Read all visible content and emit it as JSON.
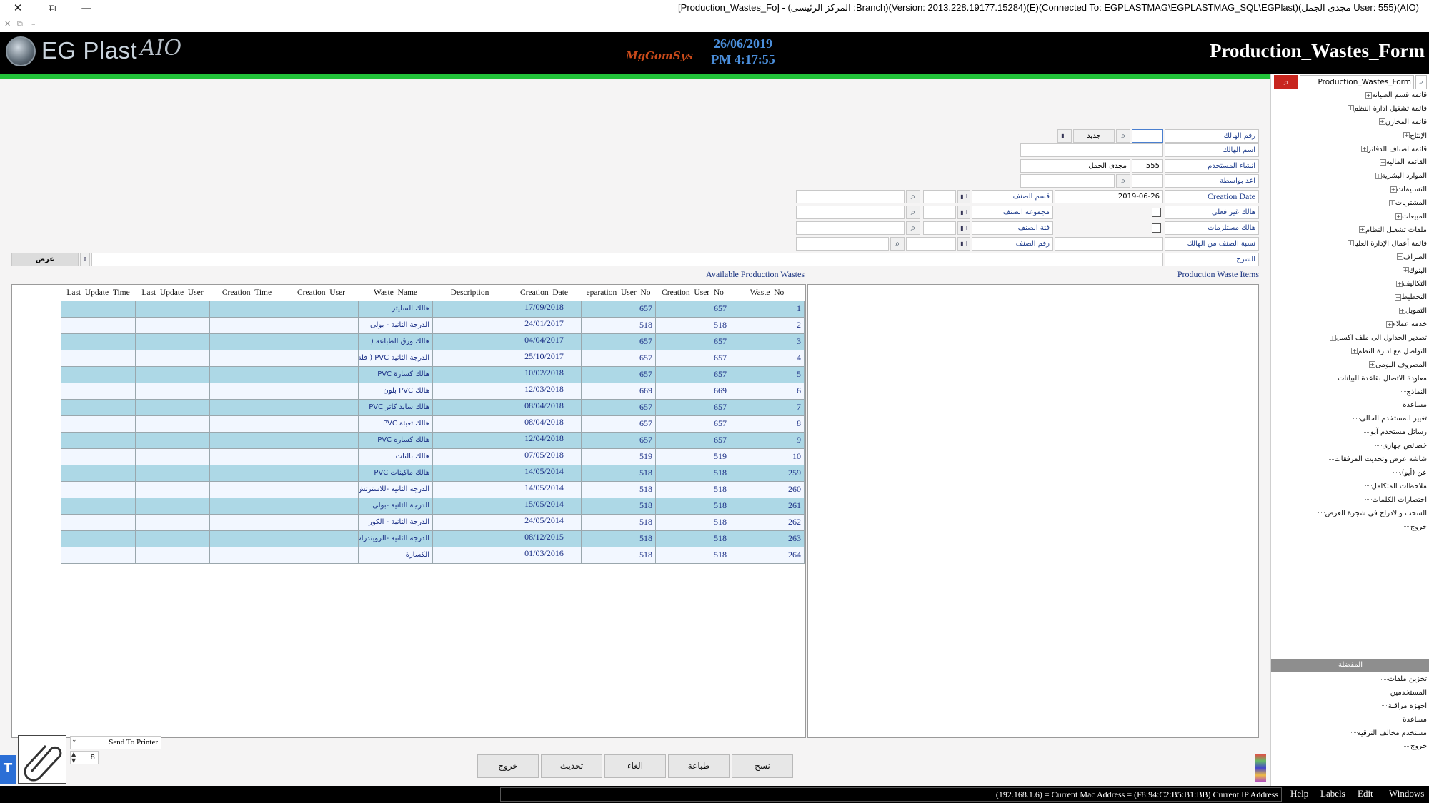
{
  "window": {
    "title": "[Production_Wastes_Fo] - (المركز الرئيسى :Branch)(Version: 2013.228.19177.15284)(E)(Connected To: EGPLASTMAG\\EGPLASTMAG_SQL\\EGPlast)(مجدى الجمل User: 555)(AIO)",
    "close": "✕",
    "restore": "⧉",
    "minimize": "—",
    "mdi_close": "✕",
    "mdi_restore": "⧉",
    "mdi_min": "–"
  },
  "header": {
    "logo_text": "EG Plast",
    "logo_suffix": "AIO",
    "vendor": "MgGomSys",
    "date": "26/06/2019",
    "time": "PM 4:17:55",
    "form_title": "Production_Wastes_Form"
  },
  "form": {
    "waste_no_label": "رقم الهالك",
    "new_label": "جديد",
    "waste_name_label": "اسم الهالك",
    "created_by_label": "انشاء المستخدم",
    "created_by_id": "555",
    "created_by_name": "مجدى الجمل",
    "prepared_by_label": "اعد بواسطة",
    "creation_date_label": "Creation Date",
    "creation_date": "2019-06-26",
    "non_actual_label": "هالك غير فعلي",
    "supplies_label": "هالك مستلزمات",
    "percent_label": "نسبة الصنف من الهالك",
    "notes_label": "الشرح",
    "item_section_label": "قسم الصنف",
    "item_group_label": "مجموعة الصنف",
    "item_class_label": "فئة الصنف",
    "item_no_label": "رقم الصنف",
    "show_label": "عرض"
  },
  "grids": {
    "left_caption": "Production Waste Items",
    "right_caption": "Available Production Wastes",
    "columns": [
      "Last_Update_Time",
      "Last_Update_User",
      "Creation_Time",
      "Creation_User",
      "Waste_Name",
      "Description",
      "Creation_Date",
      "eparation_User_No",
      "Creation_User_No",
      "Waste_No"
    ],
    "rows": [
      {
        "waste_no": "1",
        "cu_no": "657",
        "pu_no": "657",
        "date": "17/09/2018",
        "name": "هالك السليتر"
      },
      {
        "waste_no": "2",
        "cu_no": "518",
        "pu_no": "518",
        "date": "24/01/2017",
        "name": "الدرجة الثانية - بولى"
      },
      {
        "waste_no": "3",
        "cu_no": "657",
        "pu_no": "657",
        "date": "04/04/2017",
        "name": "هالك ورق الطباعة ("
      },
      {
        "waste_no": "4",
        "cu_no": "657",
        "pu_no": "657",
        "date": "25/10/2017",
        "name": "الدرجة الثانية PVC ( فلة"
      },
      {
        "waste_no": "5",
        "cu_no": "657",
        "pu_no": "657",
        "date": "10/02/2018",
        "name": "هالك كسارة PVC"
      },
      {
        "waste_no": "6",
        "cu_no": "669",
        "pu_no": "669",
        "date": "12/03/2018",
        "name": "هالك PVC بلون"
      },
      {
        "waste_no": "7",
        "cu_no": "657",
        "pu_no": "657",
        "date": "08/04/2018",
        "name": "هالك سايد كاتر PVC"
      },
      {
        "waste_no": "8",
        "cu_no": "657",
        "pu_no": "657",
        "date": "08/04/2018",
        "name": "هالك تعبئة PVC"
      },
      {
        "waste_no": "9",
        "cu_no": "657",
        "pu_no": "657",
        "date": "12/04/2018",
        "name": "هالك كسارة PVC"
      },
      {
        "waste_no": "10",
        "cu_no": "519",
        "pu_no": "519",
        "date": "07/05/2018",
        "name": "هالك بالتات"
      },
      {
        "waste_no": "259",
        "cu_no": "518",
        "pu_no": "518",
        "date": "14/05/2014",
        "name": "هالك ماكينات PVC"
      },
      {
        "waste_no": "260",
        "cu_no": "518",
        "pu_no": "518",
        "date": "14/05/2014",
        "name": "الدرجة الثانية -للاسترتش"
      },
      {
        "waste_no": "261",
        "cu_no": "518",
        "pu_no": "518",
        "date": "15/05/2014",
        "name": "الدرجة الثانية -بولى"
      },
      {
        "waste_no": "262",
        "cu_no": "518",
        "pu_no": "518",
        "date": "24/05/2014",
        "name": "الدرجة الثانية - الكور"
      },
      {
        "waste_no": "263",
        "cu_no": "518",
        "pu_no": "518",
        "date": "08/12/2015",
        "name": "الدرجة الثانية -الرويندرات"
      },
      {
        "waste_no": "264",
        "cu_no": "518",
        "pu_no": "518",
        "date": "01/03/2016",
        "name": "الكسارة"
      }
    ]
  },
  "printer": {
    "label": "Send To Printer",
    "copies": "8"
  },
  "buttons": {
    "exit": "خروج",
    "refresh": "تحديث",
    "cancel": "الغاء",
    "print": "طباعة",
    "copy": "نسخ"
  },
  "sidebar": {
    "search_value": "Production_Wastes_Form",
    "menu": [
      {
        "label": "قائمة قسم الصيانة",
        "expandable": true
      },
      {
        "label": "قائمة تشغيل ادارة النظم",
        "expandable": true
      },
      {
        "label": "قائمة المخازن",
        "expandable": true
      },
      {
        "label": "الإنتاج",
        "expandable": true
      },
      {
        "label": "قائمة اصناف الدفاتر",
        "expandable": true
      },
      {
        "label": "القائمة المالية",
        "expandable": true
      },
      {
        "label": "الموارد البشرية",
        "expandable": true
      },
      {
        "label": "التسليمات",
        "expandable": true
      },
      {
        "label": "المشتريات",
        "expandable": true
      },
      {
        "label": "المبيعات",
        "expandable": true
      },
      {
        "label": "ملفات تشغيل النظام",
        "expandable": true
      },
      {
        "label": "قائمة أعمال الإدارة العليا",
        "expandable": true
      },
      {
        "label": "الصراف",
        "expandable": true
      },
      {
        "label": "البنوك",
        "expandable": true
      },
      {
        "label": "التكاليف",
        "expandable": true
      },
      {
        "label": "التخطيط",
        "expandable": true
      },
      {
        "label": "التمويل",
        "expandable": true
      },
      {
        "label": "خدمة عملاء",
        "expandable": true
      },
      {
        "label": "تصدير الجداول الى ملف اكسل",
        "expandable": true
      },
      {
        "label": "التواصل مع ادارة النظم",
        "expandable": true
      },
      {
        "label": "المصروف اليومى",
        "expandable": true
      },
      {
        "label": "معاودة الاتصال بقاعدة البيانات",
        "expandable": false
      },
      {
        "label": "النماذج",
        "expandable": false
      },
      {
        "label": "مساعدة",
        "expandable": false
      },
      {
        "label": "تغيير المستخدم الحالى",
        "expandable": false
      },
      {
        "label": "رسائل مستخدم آيو",
        "expandable": false
      },
      {
        "label": "خصائص جهازى",
        "expandable": false
      },
      {
        "label": "شاشة عرض وتحديث المرفقات",
        "expandable": false
      },
      {
        "label": "عن (أيو).",
        "expandable": false
      },
      {
        "label": "ملاحظات المتكامل",
        "expandable": false
      },
      {
        "label": "اختصارات الكلمات",
        "expandable": false
      },
      {
        "label": "السحب والادراج فى شجرة العرض",
        "expandable": false
      },
      {
        "label": "خروج",
        "expandable": false
      }
    ],
    "favorites_title": "المفضلة",
    "favorites": [
      "تخزين ملفات",
      "المستخدمين",
      "اجهزة مراقبة",
      "مساعدة",
      "مستخدم مخالف الترقية",
      "خروج"
    ]
  },
  "status": {
    "ip": "(192.168.1.6) = Current Mac Address = (F8:94:C2:B5:B1:BB) Current IP Address",
    "help": "Help",
    "labels": "Labels",
    "edit": "Edit",
    "windows": "Windows"
  }
}
